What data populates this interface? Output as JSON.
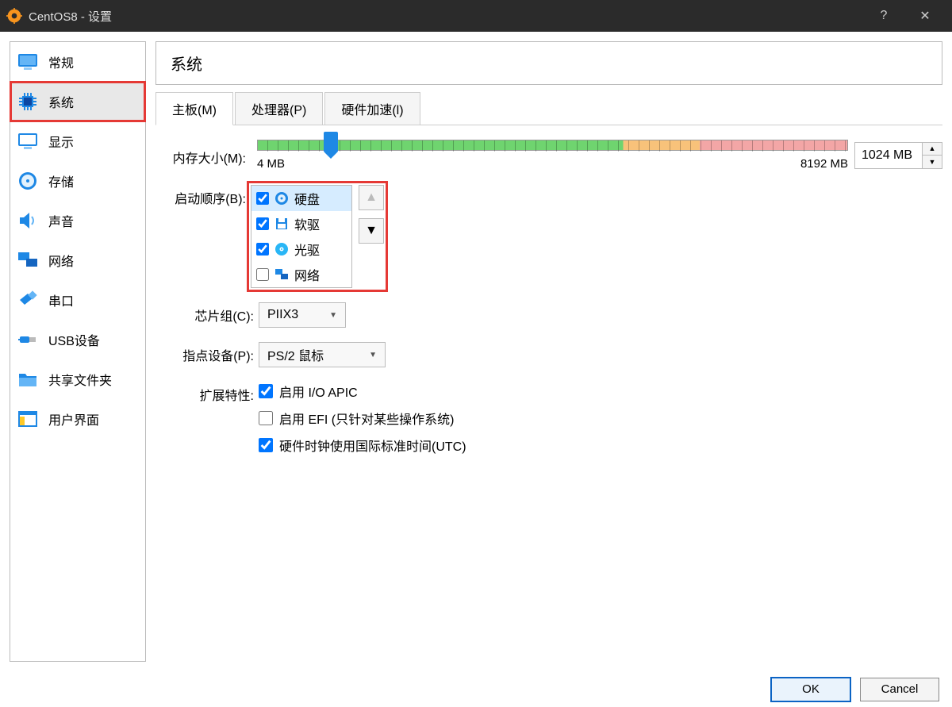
{
  "window": {
    "title": "CentOS8 - 设置",
    "help": "?",
    "close": "✕"
  },
  "sidebar": {
    "items": [
      {
        "label": "常规"
      },
      {
        "label": "系统"
      },
      {
        "label": "显示"
      },
      {
        "label": "存储"
      },
      {
        "label": "声音"
      },
      {
        "label": "网络"
      },
      {
        "label": "串口"
      },
      {
        "label": "USB设备"
      },
      {
        "label": "共享文件夹"
      },
      {
        "label": "用户界面"
      }
    ]
  },
  "page": {
    "title": "系统"
  },
  "tabs": [
    {
      "label": "主板(M)"
    },
    {
      "label": "处理器(P)"
    },
    {
      "label": "硬件加速(l)"
    }
  ],
  "memory": {
    "label": "内存大小(M):",
    "min": "4 MB",
    "max": "8192 MB",
    "value": "1024 MB"
  },
  "boot": {
    "label": "启动顺序(B):",
    "items": [
      {
        "label": "硬盘",
        "checked": true,
        "selected": true
      },
      {
        "label": "软驱",
        "checked": true,
        "selected": false
      },
      {
        "label": "光驱",
        "checked": true,
        "selected": false
      },
      {
        "label": "网络",
        "checked": false,
        "selected": false
      }
    ]
  },
  "chipset": {
    "label": "芯片组(C):",
    "value": "PIIX3"
  },
  "pointing": {
    "label": "指点设备(P):",
    "value": "PS/2 鼠标"
  },
  "extended": {
    "label": "扩展特性:",
    "items": [
      {
        "label": "启用 I/O APIC",
        "checked": true
      },
      {
        "label": "启用 EFI (只针对某些操作系统)",
        "checked": false
      },
      {
        "label": "硬件时钟使用国际标准时间(UTC)",
        "checked": true
      }
    ]
  },
  "buttons": {
    "ok": "OK",
    "cancel": "Cancel"
  }
}
